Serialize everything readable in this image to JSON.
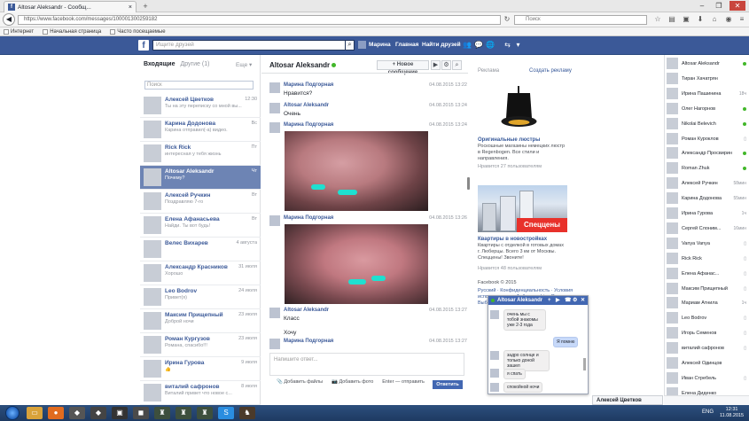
{
  "browser": {
    "tab_title": "Altosar Aleksandr - Сообщ...",
    "url": "https://www.facebook.com/messages/100001300259182",
    "search_placeholder": "Поиск",
    "bookmarks": [
      "Интернет",
      "Начальная страница",
      "Часто посещаемые"
    ]
  },
  "fb": {
    "logo": "f",
    "search_placeholder": "Ищите друзей",
    "nav": {
      "me": "Марина",
      "home": "Главная",
      "find": "Найти друзей"
    }
  },
  "inbox": {
    "tab_inbox": "Входящие",
    "tab_other": "Другие (1)",
    "more": "Еще ▾",
    "search_placeholder": "Поиск",
    "conversations": [
      {
        "name": "Алексей Цветков",
        "time": "12:30",
        "snippet": "Ты на эту переписку со мной вы..."
      },
      {
        "name": "Карина Додонова",
        "time": "Вс",
        "snippet": "Карина отправил(-а) видео."
      },
      {
        "name": "Rick Rick",
        "time": "Пт",
        "snippet": "интересная у тебя жизнь"
      },
      {
        "name": "Altosar Aleksandr",
        "time": "Чт",
        "snippet": "Почему?"
      },
      {
        "name": "Алексей Ручкин",
        "time": "Вт",
        "snippet": "Поздравляю 7-го"
      },
      {
        "name": "Елена Афанасьева",
        "time": "Вт",
        "snippet": "Найди. Ты вот будь!"
      },
      {
        "name": "Велес Вихарев",
        "time": "4 августа",
        "snippet": ""
      },
      {
        "name": "Александр Красников",
        "time": "31 июля",
        "snippet": "Хорошо"
      },
      {
        "name": "Leo Bodrov",
        "time": "24 июля",
        "snippet": "Привет(я)"
      },
      {
        "name": "Максим Прищепный",
        "time": "23 июля",
        "snippet": "Доброй ночи"
      },
      {
        "name": "Роман Кургузов",
        "time": "23 июля",
        "snippet": "Романа, спасибо!!!"
      },
      {
        "name": "Ирина Гурова",
        "time": "9 июля",
        "snippet": "👍"
      },
      {
        "name": "виталий сафронов",
        "time": "8 июля",
        "snippet": "Виталий привет что новое с..."
      }
    ]
  },
  "conversation": {
    "title": "Altosar Aleksandr",
    "new_message": "+ Новое сообщение",
    "messages": [
      {
        "name": "Марина Подгорная",
        "text": "Нравится?",
        "time": "04.08.2015 13:22"
      },
      {
        "name": "Altosar Aleksandr",
        "text": "Очень",
        "time": "04.08.2015 13:24"
      },
      {
        "name": "Марина Подгорная",
        "text": "",
        "time": "04.08.2015 13:24"
      },
      {
        "name": "Марина Подгорная",
        "text": "",
        "time": "04.08.2015 13:26"
      },
      {
        "name": "Altosar Aleksandr",
        "text": "Класс",
        "time": "04.08.2015 13:27"
      },
      {
        "name": "",
        "text": "Хочу",
        "time": ""
      },
      {
        "name": "Марина Подгорная",
        "text": "",
        "time": "04.08.2015 13:27"
      }
    ],
    "reply_placeholder": "Напишите ответ...",
    "add_files": "Добавить файлы",
    "add_photo": "Добавить фото",
    "enter_hint": "Enter — отправить",
    "send": "Ответить"
  },
  "ads": {
    "header": "Реклама",
    "create": "Создать рекламу",
    "ad1": {
      "title": "Оригинальные люстры",
      "text": "Роскошные магазины немецких люстр в Regenbogen. Все стили и направления.",
      "meta": "Нравится 27 пользователям"
    },
    "ad2": {
      "promo": "Спеццены",
      "title": "Квартиры в новостройках",
      "text": "Квартиры с отделкой в готовых домах г. Люберцы. Всего 3 км от Москвы. Спеццены! Звоните!",
      "meta": "Нравится 48 пользователям"
    },
    "footer": "Facebook © 2015",
    "links": "Русский · Конфиденциальность · Условия использования · Файлы cookie · Реклама · Выбор рекламы · Ещё ▾"
  },
  "chat": {
    "name": "Altosar Aleksandr",
    "bubbles": {
      "in1": "очень мы с тобой знакомы уже 2-3 года",
      "out1": "Я помню",
      "in2": "задро солнце и только доной зашел",
      "in3": "я спать",
      "in4": "спокойной ночи"
    }
  },
  "sidebar": {
    "friends": [
      {
        "name": "Altosar Aleksandr",
        "status": "online"
      },
      {
        "name": "Тиран Хачатрян",
        "status": ""
      },
      {
        "name": "Ирина Пашинина",
        "status": "18ч"
      },
      {
        "name": "Олег Нагорнов",
        "status": "online"
      },
      {
        "name": "Nikolai Belevich",
        "status": "online"
      },
      {
        "name": "Роман Куроклов",
        "status": "mobile"
      },
      {
        "name": "Александр Просвирин",
        "status": "online"
      },
      {
        "name": "Roman Zhuk",
        "status": "online"
      },
      {
        "name": "Алексей Ручкин",
        "status": "58мин"
      },
      {
        "name": "Карина Додонова",
        "status": "55мин"
      },
      {
        "name": "Ирина Гурова",
        "status": "1ч"
      },
      {
        "name": "Сергей Слоним...",
        "status": "16мин"
      },
      {
        "name": "Vanya Vanya",
        "status": "mobile"
      },
      {
        "name": "Rick Rick",
        "status": "mobile"
      },
      {
        "name": "Елена Афанас...",
        "status": "mobile"
      },
      {
        "name": "Максим Прищепный",
        "status": "mobile"
      },
      {
        "name": "Мариам Атнила",
        "status": "1ч"
      },
      {
        "name": "Leo Bodrov",
        "status": "mobile"
      },
      {
        "name": "Игорь Семенов",
        "status": "mobile"
      },
      {
        "name": "виталий сафронов",
        "status": "mobile"
      },
      {
        "name": "Алексей Одинцов",
        "status": ""
      },
      {
        "name": "Иван Стребель",
        "status": "mobile"
      },
      {
        "name": "Елена Диденко",
        "status": ""
      }
    ],
    "chat_tab": "Алексей Цветков"
  },
  "taskbar": {
    "lang": "ENG",
    "time": "12:31",
    "date": "11.08.2015"
  }
}
